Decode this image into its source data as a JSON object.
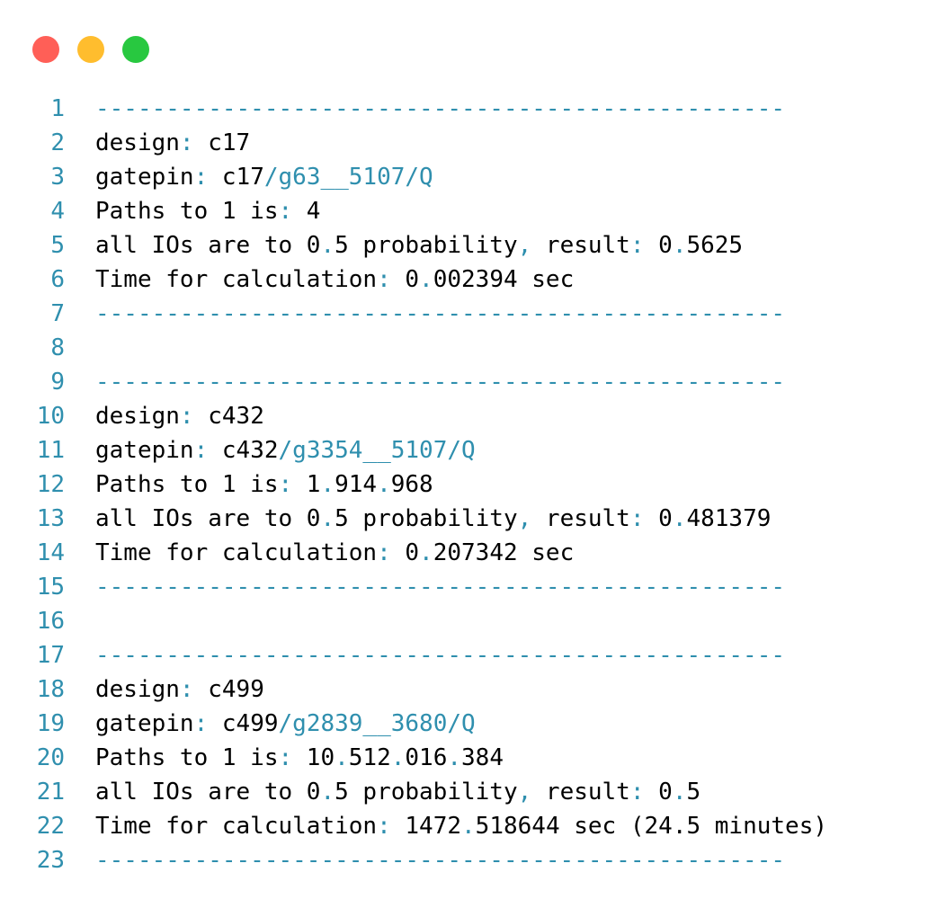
{
  "window": {
    "controls": {
      "close_color": "#ff5f57",
      "minimize_color": "#ffbd2e",
      "maximize_color": "#28c840"
    }
  },
  "colors": {
    "punctuation": "#2f8fae",
    "text": "#000000",
    "line_numbers": "#2f8fae"
  },
  "lines": [
    {
      "n": "1",
      "segments": [
        {
          "t": "-------------------------------------------------",
          "c": "p"
        }
      ]
    },
    {
      "n": "2",
      "segments": [
        {
          "t": "design",
          "c": ""
        },
        {
          "t": ":",
          "c": "p"
        },
        {
          "t": " c17",
          "c": ""
        }
      ]
    },
    {
      "n": "3",
      "segments": [
        {
          "t": "gatepin",
          "c": ""
        },
        {
          "t": ":",
          "c": "p"
        },
        {
          "t": " c17",
          "c": ""
        },
        {
          "t": "/g63__5107/Q",
          "c": "p"
        }
      ]
    },
    {
      "n": "4",
      "segments": [
        {
          "t": "Paths to 1 is",
          "c": ""
        },
        {
          "t": ":",
          "c": "p"
        },
        {
          "t": " 4",
          "c": ""
        }
      ]
    },
    {
      "n": "5",
      "segments": [
        {
          "t": "all IOs are to 0",
          "c": ""
        },
        {
          "t": ".",
          "c": "p"
        },
        {
          "t": "5 probability",
          "c": ""
        },
        {
          "t": ",",
          "c": "p"
        },
        {
          "t": " result",
          "c": ""
        },
        {
          "t": ":",
          "c": "p"
        },
        {
          "t": " 0",
          "c": ""
        },
        {
          "t": ".",
          "c": "p"
        },
        {
          "t": "5625",
          "c": ""
        }
      ]
    },
    {
      "n": "6",
      "segments": [
        {
          "t": "Time for calculation",
          "c": ""
        },
        {
          "t": ":",
          "c": "p"
        },
        {
          "t": " 0",
          "c": ""
        },
        {
          "t": ".",
          "c": "p"
        },
        {
          "t": "002394 sec",
          "c": ""
        }
      ]
    },
    {
      "n": "7",
      "segments": [
        {
          "t": "-------------------------------------------------",
          "c": "p"
        }
      ]
    },
    {
      "n": "8",
      "segments": []
    },
    {
      "n": "9",
      "segments": [
        {
          "t": "-------------------------------------------------",
          "c": "p"
        }
      ]
    },
    {
      "n": "10",
      "segments": [
        {
          "t": "design",
          "c": ""
        },
        {
          "t": ":",
          "c": "p"
        },
        {
          "t": " c432",
          "c": ""
        }
      ]
    },
    {
      "n": "11",
      "segments": [
        {
          "t": "gatepin",
          "c": ""
        },
        {
          "t": ":",
          "c": "p"
        },
        {
          "t": " c432",
          "c": ""
        },
        {
          "t": "/g3354__5107/Q",
          "c": "p"
        }
      ]
    },
    {
      "n": "12",
      "segments": [
        {
          "t": "Paths to 1 is",
          "c": ""
        },
        {
          "t": ":",
          "c": "p"
        },
        {
          "t": " 1",
          "c": ""
        },
        {
          "t": ".",
          "c": "p"
        },
        {
          "t": "914",
          "c": ""
        },
        {
          "t": ".",
          "c": "p"
        },
        {
          "t": "968",
          "c": ""
        }
      ]
    },
    {
      "n": "13",
      "segments": [
        {
          "t": "all IOs are to 0",
          "c": ""
        },
        {
          "t": ".",
          "c": "p"
        },
        {
          "t": "5 probability",
          "c": ""
        },
        {
          "t": ",",
          "c": "p"
        },
        {
          "t": " result",
          "c": ""
        },
        {
          "t": ":",
          "c": "p"
        },
        {
          "t": " 0",
          "c": ""
        },
        {
          "t": ".",
          "c": "p"
        },
        {
          "t": "481379",
          "c": ""
        }
      ]
    },
    {
      "n": "14",
      "segments": [
        {
          "t": "Time for calculation",
          "c": ""
        },
        {
          "t": ":",
          "c": "p"
        },
        {
          "t": " 0",
          "c": ""
        },
        {
          "t": ".",
          "c": "p"
        },
        {
          "t": "207342 sec",
          "c": ""
        }
      ]
    },
    {
      "n": "15",
      "segments": [
        {
          "t": "-------------------------------------------------",
          "c": "p"
        }
      ]
    },
    {
      "n": "16",
      "segments": []
    },
    {
      "n": "17",
      "segments": [
        {
          "t": "-------------------------------------------------",
          "c": "p"
        }
      ]
    },
    {
      "n": "18",
      "segments": [
        {
          "t": "design",
          "c": ""
        },
        {
          "t": ":",
          "c": "p"
        },
        {
          "t": " c499",
          "c": ""
        }
      ]
    },
    {
      "n": "19",
      "segments": [
        {
          "t": "gatepin",
          "c": ""
        },
        {
          "t": ":",
          "c": "p"
        },
        {
          "t": " c499",
          "c": ""
        },
        {
          "t": "/g2839__3680/Q",
          "c": "p"
        }
      ]
    },
    {
      "n": "20",
      "segments": [
        {
          "t": "Paths to 1 is",
          "c": ""
        },
        {
          "t": ":",
          "c": "p"
        },
        {
          "t": " 10",
          "c": ""
        },
        {
          "t": ".",
          "c": "p"
        },
        {
          "t": "512",
          "c": ""
        },
        {
          "t": ".",
          "c": "p"
        },
        {
          "t": "016",
          "c": ""
        },
        {
          "t": ".",
          "c": "p"
        },
        {
          "t": "384",
          "c": ""
        }
      ]
    },
    {
      "n": "21",
      "segments": [
        {
          "t": "all IOs are to 0",
          "c": ""
        },
        {
          "t": ".",
          "c": "p"
        },
        {
          "t": "5 probability",
          "c": ""
        },
        {
          "t": ",",
          "c": "p"
        },
        {
          "t": " result",
          "c": ""
        },
        {
          "t": ":",
          "c": "p"
        },
        {
          "t": " 0",
          "c": ""
        },
        {
          "t": ".",
          "c": "p"
        },
        {
          "t": "5",
          "c": ""
        }
      ]
    },
    {
      "n": "22",
      "segments": [
        {
          "t": "Time for calculation",
          "c": ""
        },
        {
          "t": ":",
          "c": "p"
        },
        {
          "t": " 1472",
          "c": ""
        },
        {
          "t": ".",
          "c": "p"
        },
        {
          "t": "518644 sec (24.5 minutes)",
          "c": ""
        }
      ]
    },
    {
      "n": "23",
      "segments": [
        {
          "t": "-------------------------------------------------",
          "c": "p"
        }
      ]
    }
  ]
}
